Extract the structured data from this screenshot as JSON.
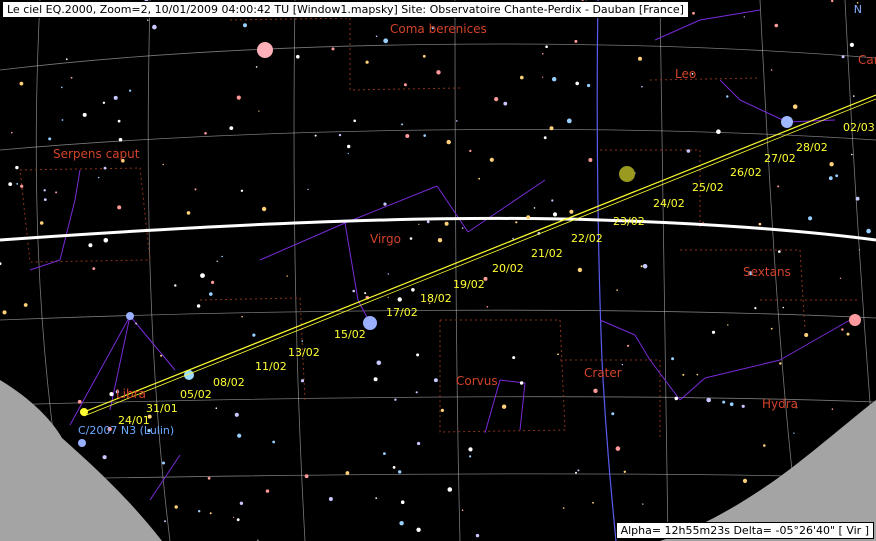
{
  "window": {
    "title": "Le ciel EQ.2000, Zoom=2, 10/01/2009 04:00:42 TU [Window1.mapsky]  Site: Observatoire Chante-Perdix - Dauban [France]"
  },
  "status": {
    "text": "Alpha= 12h55m23s Delta= -05°26'40\" [ Vir ]"
  },
  "compass": {
    "north": "N"
  },
  "constellations": [
    {
      "name": "Coma berenices"
    },
    {
      "name": "Leo"
    },
    {
      "name": "Can"
    },
    {
      "name": "Serpens caput"
    },
    {
      "name": "Virgo"
    },
    {
      "name": "Sextans"
    },
    {
      "name": "Corvus"
    },
    {
      "name": "Crater"
    },
    {
      "name": "Hydra"
    },
    {
      "name": "Libra"
    }
  ],
  "comet": {
    "name": "C/2007 N3 (Lulin)",
    "dates": [
      "24/01",
      "31/01",
      "05/02",
      "08/02",
      "11/02",
      "13/02",
      "15/02",
      "17/02",
      "18/02",
      "19/02",
      "20/02",
      "21/02",
      "22/02",
      "23/02",
      "24/02",
      "25/02",
      "26/02",
      "27/02",
      "28/02",
      "02/03"
    ]
  },
  "colors": {
    "background": "#000000",
    "grid": "#c8c8c8",
    "constellation_lines": "#7a2ad8",
    "boundaries": "#8a3418",
    "constellation_names": "#d2432a",
    "comet_path": "#ffff32",
    "ecliptic": "#ffffff",
    "galactic": "#5a5cf0",
    "horizon": "#a8a8a8"
  }
}
